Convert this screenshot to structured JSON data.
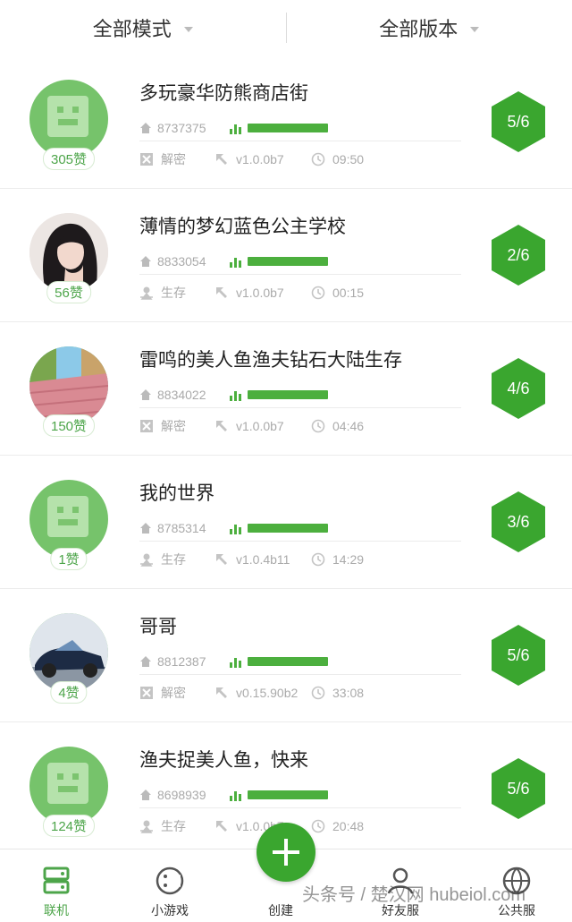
{
  "filters": {
    "mode_label": "全部模式",
    "version_label": "全部版本"
  },
  "rooms": [
    {
      "title": "多玩豪华防熊商店街",
      "room_id": "8737375",
      "mode": "解密",
      "mode_icon": "puzzle-icon",
      "version": "v1.0.0b7",
      "time": "09:50",
      "likes": "305赞",
      "players": "5/6",
      "avatar": "creeper"
    },
    {
      "title": "薄情的梦幻蓝色公主学校",
      "room_id": "8833054",
      "mode": "生存",
      "mode_icon": "survival-icon",
      "version": "v1.0.0b7",
      "time": "00:15",
      "likes": "56赞",
      "players": "2/6",
      "avatar": "girl-photo"
    },
    {
      "title": "雷鸣的美人鱼渔夫钻石大陆生存",
      "room_id": "8834022",
      "mode": "解密",
      "mode_icon": "puzzle-icon",
      "version": "v1.0.0b7",
      "time": "04:46",
      "likes": "150赞",
      "players": "4/6",
      "avatar": "blocks-photo"
    },
    {
      "title": "我的世界",
      "room_id": "8785314",
      "mode": "生存",
      "mode_icon": "survival-icon",
      "version": "v1.0.4b11",
      "time": "14:29",
      "likes": "1赞",
      "players": "3/6",
      "avatar": "creeper"
    },
    {
      "title": "哥哥",
      "room_id": "8812387",
      "mode": "解密",
      "mode_icon": "puzzle-icon",
      "version": "v0.15.90b2",
      "time": "33:08",
      "likes": "4赞",
      "players": "5/6",
      "avatar": "car-photo"
    },
    {
      "title": "渔夫捉美人鱼，快来",
      "room_id": "8698939",
      "mode": "生存",
      "mode_icon": "survival-icon",
      "version": "v1.0.0b7",
      "time": "20:48",
      "likes": "124赞",
      "players": "5/6",
      "avatar": "creeper"
    }
  ],
  "nav": {
    "online": "联机",
    "minigames": "小游戏",
    "create": "创建",
    "friends": "好友服",
    "public": "公共服"
  },
  "watermark": "头条号 / 楚汉网 hubeiol.com",
  "colors": {
    "accent": "#4caf3e",
    "hex_badge": "#3aa62f",
    "avatar_green": "#76c36b"
  }
}
